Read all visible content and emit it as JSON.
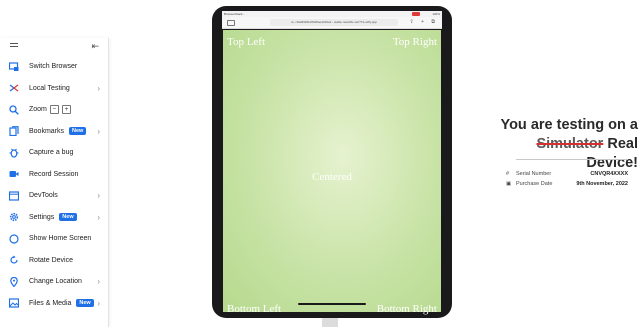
{
  "sidebar": {
    "items": [
      {
        "label": "Switch Browser",
        "icon": "monitor-switch-icon",
        "chevron": false,
        "badge": ""
      },
      {
        "label": "Local Testing",
        "icon": "local-testing-icon",
        "chevron": true,
        "badge": ""
      },
      {
        "label": "Zoom",
        "icon": "zoom-icon",
        "chevron": false,
        "badge": ""
      },
      {
        "label": "Bookmarks",
        "icon": "bookmarks-icon",
        "chevron": true,
        "badge": "New"
      },
      {
        "label": "Capture a bug",
        "icon": "bug-icon",
        "chevron": false,
        "badge": ""
      },
      {
        "label": "Record Session",
        "icon": "record-icon",
        "chevron": false,
        "badge": ""
      },
      {
        "label": "DevTools",
        "icon": "devtools-icon",
        "chevron": true,
        "badge": ""
      },
      {
        "label": "Settings",
        "icon": "gear-icon",
        "chevron": true,
        "badge": "New"
      },
      {
        "label": "Show Home Screen",
        "icon": "home-circle-icon",
        "chevron": false,
        "badge": ""
      },
      {
        "label": "Rotate Device",
        "icon": "rotate-icon",
        "chevron": false,
        "badge": ""
      },
      {
        "label": "Change Location",
        "icon": "location-pin-icon",
        "chevron": true,
        "badge": ""
      },
      {
        "label": "Files & Media",
        "icon": "image-icon",
        "chevron": true,
        "badge": "New"
      }
    ],
    "zoom_minus": "−",
    "zoom_plus": "+",
    "accent": "#1f6fe6"
  },
  "device": {
    "status_left": "BrowserStack...",
    "status_right": "100%",
    "url": "ra • 96a8326bcf8d6fae4b29e3 - stable.ravioffle.net/?72+stffy.app",
    "screen": {
      "top_left": "Top Left",
      "top_right": "Top Right",
      "center": "Centered",
      "bottom_left": "Bottom Left",
      "bottom_right": "Bottom Right"
    }
  },
  "info": {
    "title_line1": "You are testing on a",
    "struck_word": "Simulator",
    "title_line2_rest": " Real Device!",
    "serial_label": "Serial Number",
    "serial_value": "CNVQR4XXXX",
    "purchase_label": "Purchase Date",
    "purchase_value": "9th November, 2022"
  }
}
